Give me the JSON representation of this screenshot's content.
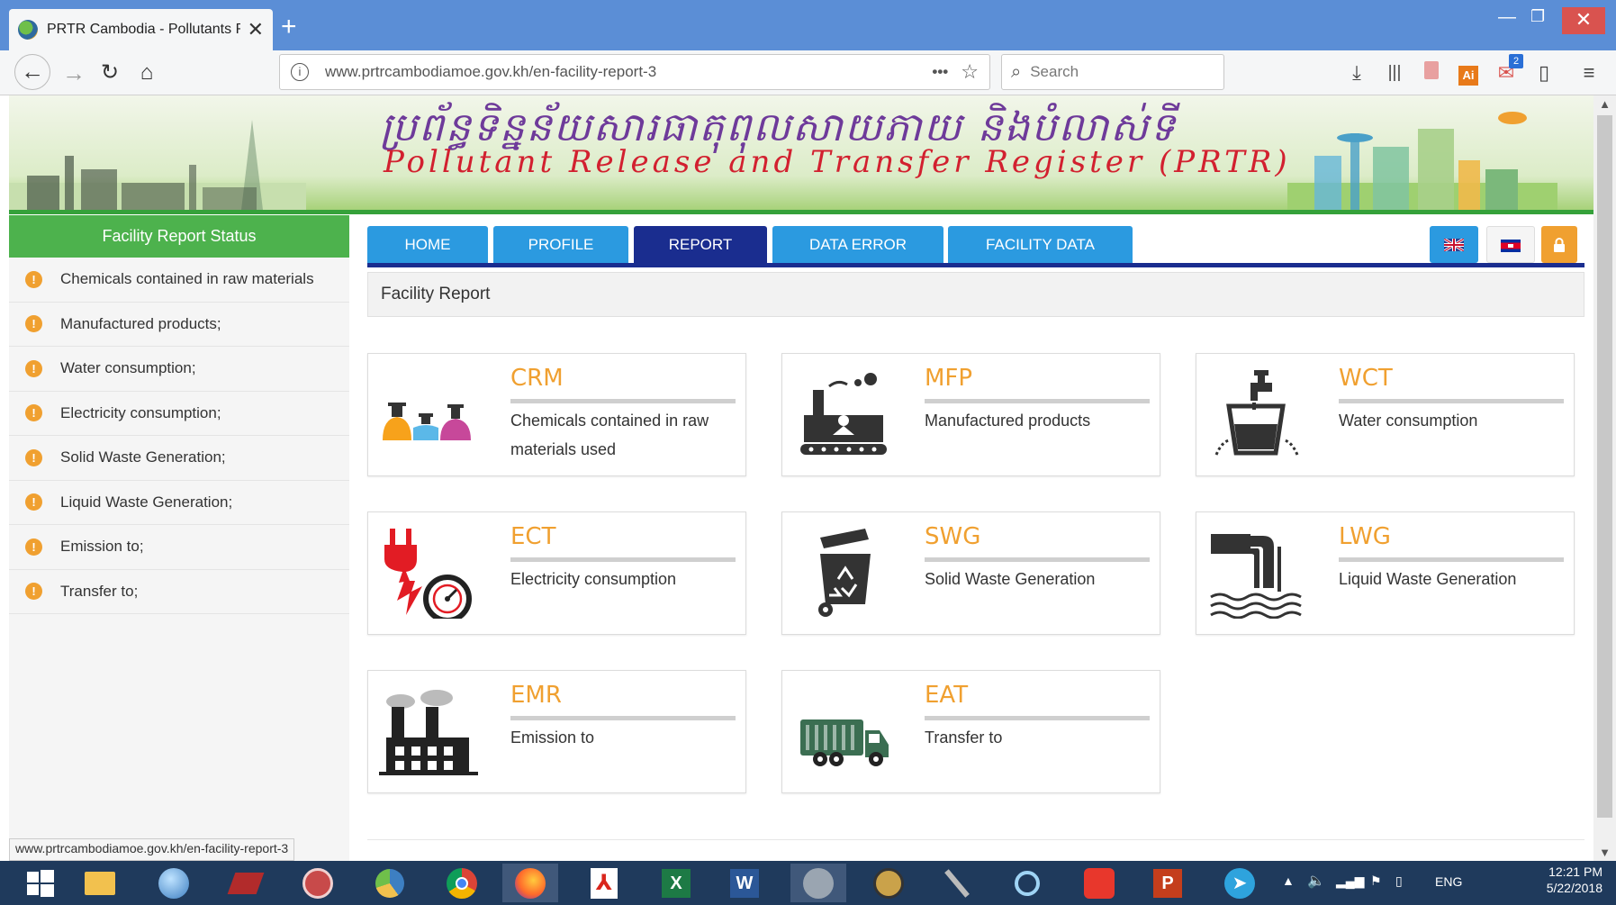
{
  "browser": {
    "tab_title": "PRTR Cambodia - Pollutants Re",
    "new_tab": "+",
    "url": "www.prtrcambodiamoe.gov.kh/en-facility-report-3",
    "search_placeholder": "Search",
    "mail_badge": "2"
  },
  "banner": {
    "khmer_title": "ប្រព័ន្ធទិន្នន័យសារធាតុពុលសាយភាយ និងបំលាស់ទី",
    "english_title": "Pollutant Release and Transfer Register (PRTR)"
  },
  "sidebar": {
    "heading": "Facility Report Status",
    "items": [
      {
        "label": "Chemicals contained in raw materials"
      },
      {
        "label": "Manufactured products;"
      },
      {
        "label": "Water consumption;"
      },
      {
        "label": "Electricity consumption;"
      },
      {
        "label": "Solid Waste Generation;"
      },
      {
        "label": "Liquid Waste Generation;"
      },
      {
        "label": "Emission to;"
      },
      {
        "label": "Transfer to;"
      }
    ]
  },
  "menu": {
    "tabs": [
      {
        "label": "HOME"
      },
      {
        "label": "PROFILE"
      },
      {
        "label": "REPORT"
      },
      {
        "label": "DATA ERROR"
      },
      {
        "label": "FACILITY DATA"
      }
    ],
    "active_tab": "REPORT"
  },
  "breadcrumb": "Facility Report",
  "cards": [
    {
      "code": "CRM",
      "desc": "Chemicals contained in raw materials used",
      "icon": "chemical-bottles-icon"
    },
    {
      "code": "MFP",
      "desc": "Manufactured products",
      "icon": "factory-conveyor-icon"
    },
    {
      "code": "WCT",
      "desc": "Water consumption",
      "icon": "water-tap-icon"
    },
    {
      "code": "ECT",
      "desc": "Electricity consumption",
      "icon": "electric-plug-meter-icon"
    },
    {
      "code": "SWG",
      "desc": "Solid Waste Generation",
      "icon": "recycle-bin-icon"
    },
    {
      "code": "LWG",
      "desc": "Liquid Waste Generation",
      "icon": "wastewater-pipe-icon"
    },
    {
      "code": "EMR",
      "desc": "Emission to",
      "icon": "factory-emission-icon"
    },
    {
      "code": "EAT",
      "desc": "Transfer to",
      "icon": "transfer-truck-icon"
    }
  ],
  "status_bar_url": "www.prtrcambodiamoe.gov.kh/en-facility-report-3",
  "taskbar": {
    "language": "ENG",
    "time": "12:21 PM",
    "date": "5/22/2018"
  },
  "colors": {
    "accent_green": "#4db24d",
    "menu_blue": "#2b9ae0",
    "menu_active": "#1a2d8f",
    "code_orange": "#f0a030"
  }
}
